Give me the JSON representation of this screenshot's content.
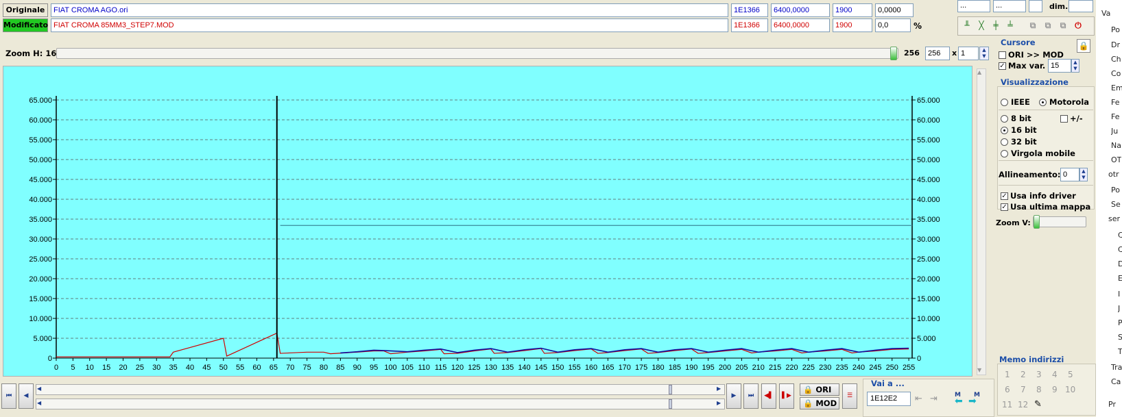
{
  "files": {
    "original": {
      "label": "Originale",
      "name": "FIAT CROMA AGO.ori",
      "address": "1E1366",
      "freq": "6400,0000",
      "len": "1900",
      "value": "0,0000"
    },
    "modified": {
      "label": "Modificato",
      "name": "FIAT CROMA 85MM3_STEP7.MOD",
      "address": "1E1366",
      "freq": "6400,0000",
      "len": "1900",
      "value": "0,0",
      "unit": "%"
    }
  },
  "topright": {
    "field1": "...",
    "field2": "...",
    "dim_label": "dim."
  },
  "zoom": {
    "label": "Zoom H: 16",
    "value_display": "256",
    "value_box": "256",
    "times": "x",
    "mult": "1"
  },
  "cursore": {
    "title": "Cursore",
    "ori_mod": "ORI >> MOD",
    "ori_mod_checked": false,
    "maxvar_label": "Max var.",
    "maxvar_checked": true,
    "maxvar_value": "15"
  },
  "visualizzazione": {
    "title": "Visualizzazione",
    "ieee": "IEEE",
    "motorola": "Motorola",
    "bit8": "8 bit",
    "plusminus": "+/-",
    "bit16": "16 bit",
    "bit32": "32 bit",
    "virgola": "Virgola mobile",
    "allineamento_label": "Allineamento:",
    "allineamento_value": "0",
    "usa_info": "Usa info driver",
    "usa_ultima": "Usa ultima mappa",
    "zoomv": "Zoom V:"
  },
  "memo": {
    "title": "Memo indirizzi",
    "numbers": [
      "1",
      "2",
      "3",
      "4",
      "5",
      "6",
      "7",
      "8",
      "9",
      "10",
      "11",
      "12"
    ]
  },
  "bottom": {
    "ori": "ORI",
    "mod": "MOD",
    "vai_title": "Vai a ...",
    "vai_value": "1E12E2",
    "m1": "M",
    "m2": "M"
  },
  "tree": [
    "Va",
    "Po",
    "Dr",
    "Ch",
    "Co",
    "Em",
    "Fe",
    "Fe",
    "Ju",
    "Na",
    "OT",
    "otr",
    "Po",
    "Se",
    "ser",
    "C",
    "C",
    "D",
    "E",
    "I",
    "J",
    "P",
    "S",
    "T",
    "Tra",
    "Ca",
    "Pr"
  ],
  "chart_data": {
    "type": "line",
    "yticks": [
      "65.000",
      "60.000",
      "55.000",
      "50.000",
      "45.000",
      "40.000",
      "35.000",
      "30.000",
      "25.000",
      "20.000",
      "15.000",
      "10.000",
      "5.000",
      "0"
    ],
    "xticks": [
      "0",
      "5",
      "10",
      "15",
      "20",
      "25",
      "30",
      "35",
      "40",
      "45",
      "50",
      "55",
      "60",
      "65",
      "70",
      "75",
      "80",
      "85",
      "90",
      "95",
      "100",
      "105",
      "110",
      "115",
      "120",
      "125",
      "130",
      "135",
      "140",
      "145",
      "150",
      "155",
      "160",
      "165",
      "170",
      "175",
      "180",
      "185",
      "190",
      "195",
      "200",
      "205",
      "210",
      "215",
      "220",
      "225",
      "230",
      "235",
      "240",
      "245",
      "250",
      "255"
    ],
    "ylim": [
      0,
      65000
    ],
    "xlim": [
      0,
      256
    ],
    "cursor_x": 66,
    "series": [
      {
        "color": "#d00000",
        "points": [
          [
            0,
            300
          ],
          [
            34,
            300
          ],
          [
            35,
            1500
          ],
          [
            50,
            5000
          ],
          [
            51,
            500
          ],
          [
            66,
            6300
          ],
          [
            67,
            1200
          ],
          [
            75,
            1500
          ],
          [
            80,
            1500
          ],
          [
            82,
            1100
          ],
          [
            90,
            1500
          ],
          [
            95,
            1800
          ],
          [
            98,
            1800
          ],
          [
            100,
            1100
          ],
          [
            105,
            1500
          ],
          [
            110,
            1800
          ],
          [
            115,
            2200
          ],
          [
            116,
            1100
          ],
          [
            120,
            1200
          ],
          [
            125,
            1800
          ],
          [
            130,
            2300
          ],
          [
            131,
            1200
          ],
          [
            135,
            1400
          ],
          [
            140,
            1900
          ],
          [
            145,
            2400
          ],
          [
            146,
            1200
          ],
          [
            150,
            1400
          ],
          [
            155,
            1900
          ],
          [
            160,
            2300
          ],
          [
            162,
            1200
          ],
          [
            165,
            1400
          ],
          [
            170,
            1900
          ],
          [
            175,
            2300
          ],
          [
            177,
            1200
          ],
          [
            180,
            1400
          ],
          [
            185,
            1900
          ],
          [
            190,
            2300
          ],
          [
            192,
            1200
          ],
          [
            195,
            1400
          ],
          [
            200,
            1800
          ],
          [
            205,
            2200
          ],
          [
            208,
            1300
          ],
          [
            210,
            1500
          ],
          [
            215,
            1800
          ],
          [
            220,
            2200
          ],
          [
            223,
            1300
          ],
          [
            225,
            1500
          ],
          [
            230,
            1800
          ],
          [
            235,
            2200
          ],
          [
            238,
            1300
          ],
          [
            240,
            1500
          ],
          [
            245,
            1800
          ],
          [
            250,
            2200
          ],
          [
            255,
            2300
          ]
        ]
      },
      {
        "color": "#1010a0",
        "points": [
          [
            85,
            1300
          ],
          [
            90,
            1600
          ],
          [
            95,
            2000
          ],
          [
            98,
            1900
          ],
          [
            105,
            1600
          ],
          [
            110,
            2000
          ],
          [
            115,
            2300
          ],
          [
            120,
            1400
          ],
          [
            125,
            2000
          ],
          [
            130,
            2400
          ],
          [
            135,
            1500
          ],
          [
            140,
            2100
          ],
          [
            145,
            2500
          ],
          [
            150,
            1500
          ],
          [
            155,
            2100
          ],
          [
            160,
            2400
          ],
          [
            165,
            1500
          ],
          [
            170,
            2100
          ],
          [
            175,
            2400
          ],
          [
            180,
            1500
          ],
          [
            185,
            2100
          ],
          [
            190,
            2400
          ],
          [
            195,
            1500
          ],
          [
            200,
            2000
          ],
          [
            205,
            2400
          ],
          [
            210,
            1500
          ],
          [
            215,
            2000
          ],
          [
            220,
            2400
          ],
          [
            225,
            1500
          ],
          [
            230,
            2000
          ],
          [
            235,
            2400
          ],
          [
            240,
            1500
          ],
          [
            245,
            2000
          ],
          [
            250,
            2400
          ],
          [
            255,
            2500
          ]
        ]
      },
      {
        "color": "#3a8a9a",
        "points": [
          [
            67,
            33400
          ],
          [
            256,
            33400
          ]
        ]
      }
    ]
  }
}
